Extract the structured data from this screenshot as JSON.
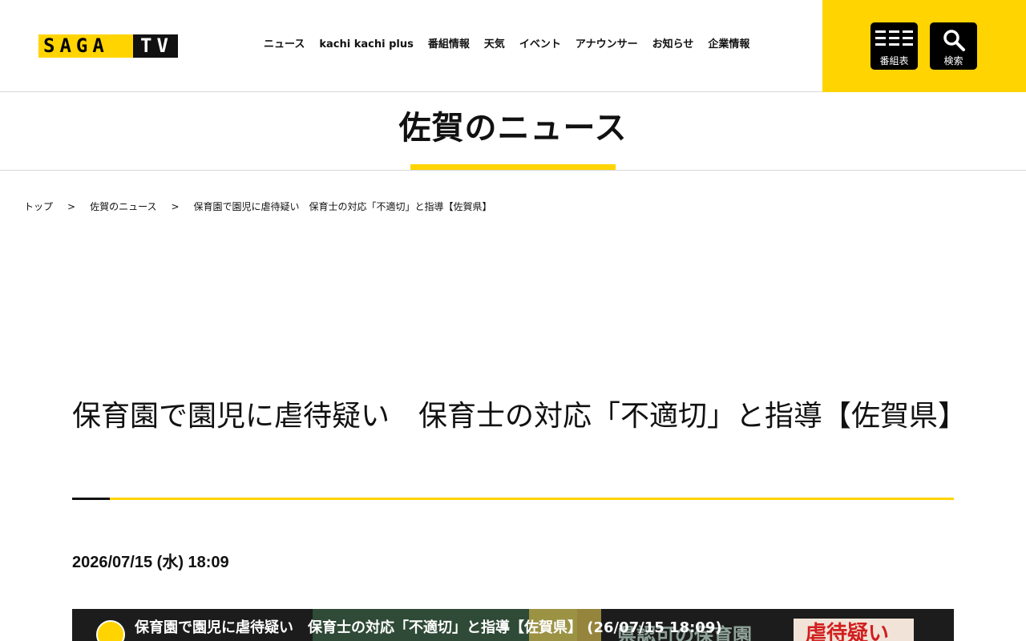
{
  "header": {
    "logo": {
      "left": "SAGA",
      "right": "TV"
    },
    "nav": [
      "ニュース",
      "kachi kachi plus",
      "番組情報",
      "天気",
      "イベント",
      "アナウンサー",
      "お知らせ",
      "企業情報"
    ],
    "buttons": {
      "program_label": "番組表",
      "search_label": "検索"
    },
    "colors": {
      "accent": "#ffd400",
      "button_bg": "#000000"
    }
  },
  "section": {
    "title": "佐賀のニュース"
  },
  "breadcrumb": {
    "items": [
      "トップ",
      "佐賀のニュース",
      "保育園で園児に虐待疑い　保育士の対応「不適切」と指導【佐賀県】"
    ],
    "separator": ">"
  },
  "article": {
    "title": "保育園で園児に虐待疑い　保育士の対応「不適切」と指導【佐賀県】",
    "date": "2026/07/15 (水) 18:09"
  },
  "video": {
    "title": "保育園で園児に虐待疑い　保育士の対応「不適切」と指導【佐賀県】 (26/07/15 18:09)",
    "overlay_text": "虐待疑い",
    "bg_text": "県認可の保育園"
  }
}
